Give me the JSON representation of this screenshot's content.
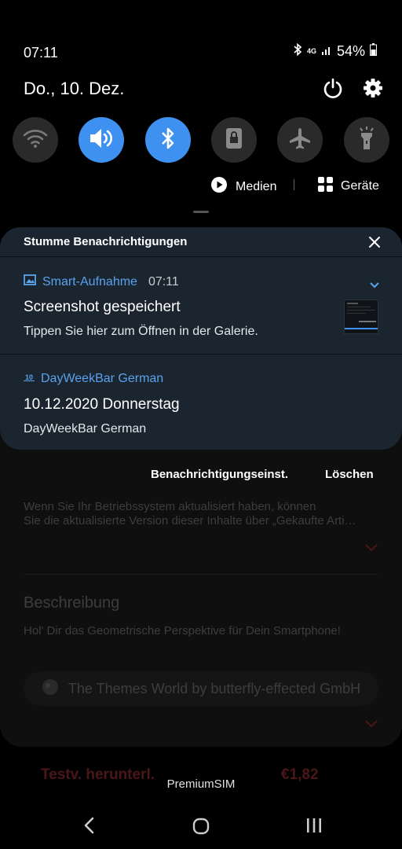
{
  "status_bar": {
    "time": "07:11",
    "network": "4G",
    "battery": "54%"
  },
  "header": {
    "date": "Do., 10. Dez."
  },
  "quick_toggles": [
    {
      "name": "wifi",
      "state": "off"
    },
    {
      "name": "sound",
      "state": "on"
    },
    {
      "name": "bluetooth",
      "state": "on"
    },
    {
      "name": "screen-lock",
      "state": "off"
    },
    {
      "name": "airplane",
      "state": "off"
    },
    {
      "name": "flashlight",
      "state": "off"
    }
  ],
  "media_row": {
    "media_label": "Medien",
    "devices_label": "Geräte"
  },
  "notifications": {
    "section_title": "Stumme Benachrichtigungen",
    "items": [
      {
        "app": "Smart-Aufnahme",
        "time": "07:11",
        "title": "Screenshot gespeichert",
        "text": "Tippen Sie hier zum Öffnen in der Galerie."
      },
      {
        "app": "DayWeekBar German",
        "icon_text": "10",
        "title": "10.12.2020 Donnerstag",
        "text": "DayWeekBar German"
      }
    ],
    "settings_label": "Benachrichtigungseinst.",
    "clear_label": "Löschen"
  },
  "background_page": {
    "update_line1": "Wenn Sie Ihr Betriebssystem aktualisiert haben, können",
    "update_line2": "Sie die aktualisierte Version dieser Inhalte über „Gekaufte Arti…",
    "description_title": "Beschreibung",
    "description_text": "Hol' Dir das Geometrische Perspektive für Dein Smartphone!",
    "publisher": "The Themes World by butterfly-effected GmbH",
    "trial_label": "Testv. herunterl.",
    "price": "€1,82"
  },
  "carrier": "PremiumSIM",
  "colors": {
    "accent": "#3e91f0",
    "card_bg": "#1b2530",
    "app_name": "#5aa2ec"
  }
}
